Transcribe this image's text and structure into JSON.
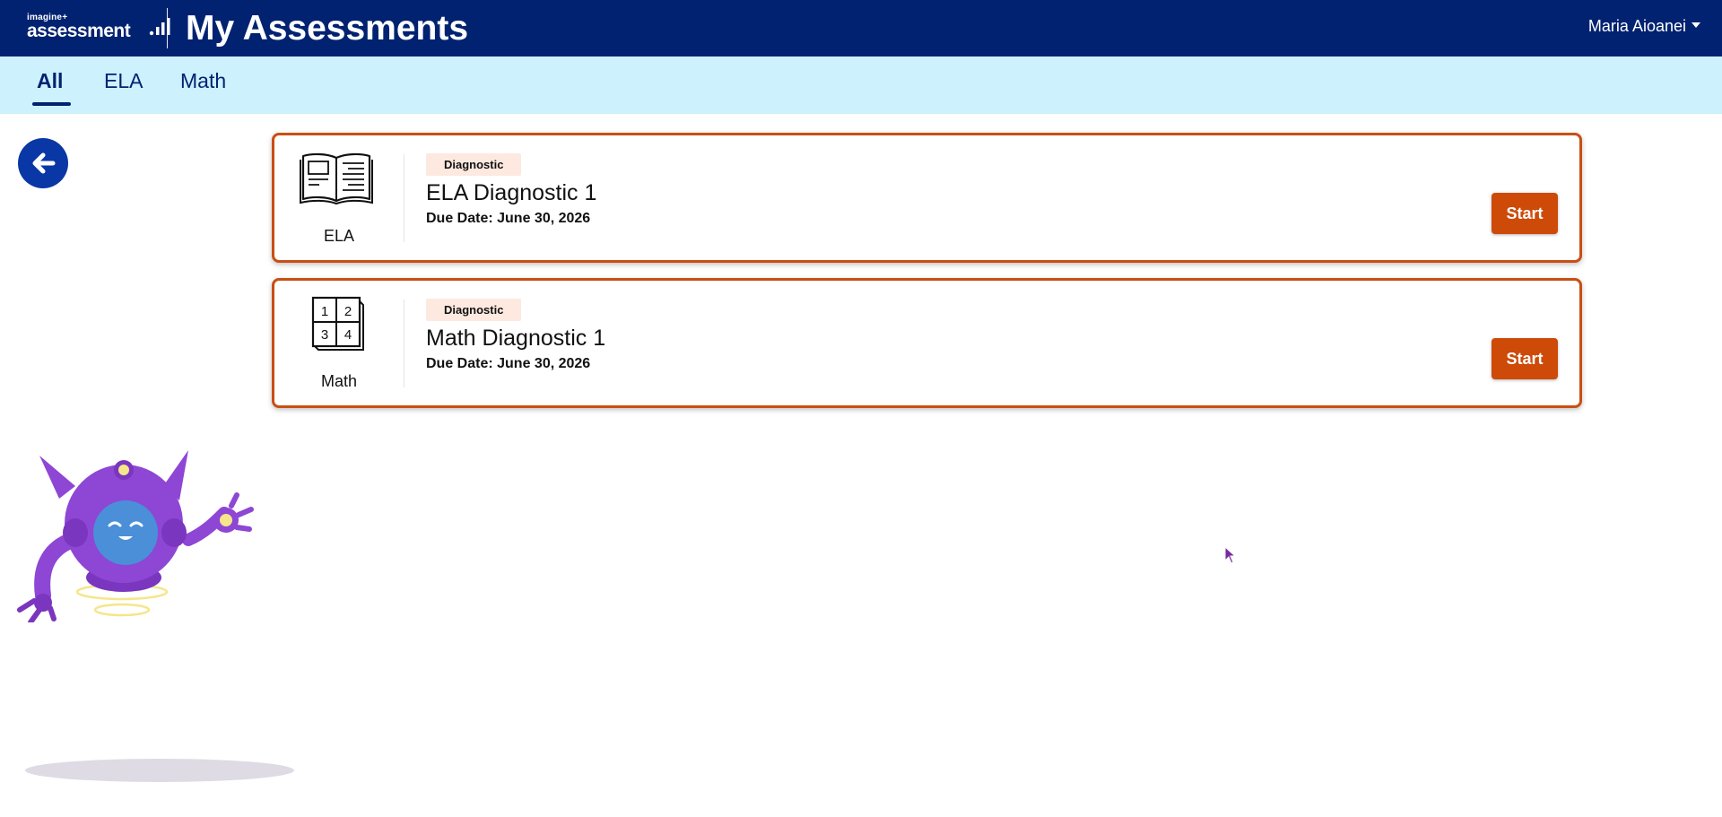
{
  "header": {
    "logo_small": "imagine+",
    "logo_big": "assessment",
    "page_title": "My Assessments",
    "user_name": "Maria Aioanei",
    "background": "#012271"
  },
  "tabs": [
    {
      "label": "All",
      "active": true
    },
    {
      "label": "ELA",
      "active": false
    },
    {
      "label": "Math",
      "active": false
    }
  ],
  "back_button": {
    "icon": "arrow-left-icon"
  },
  "assessments": [
    {
      "subject": "ELA",
      "subject_icon": "open-book-icon",
      "badge": "Diagnostic",
      "title": "ELA Diagnostic 1",
      "due": "Due Date: June 30, 2026",
      "action": "Start"
    },
    {
      "subject": "Math",
      "subject_icon": "number-grid-icon",
      "badge": "Diagnostic",
      "title": "Math Diagnostic 1",
      "due": "Due Date: June 30, 2026",
      "action": "Start",
      "grid_digits": [
        "1",
        "2",
        "3",
        "4"
      ]
    }
  ],
  "colors": {
    "accent": "#cd4a08",
    "tabbar": "#cdf1fd",
    "badge_bg": "#fde9e0",
    "mascot": "#8e46d4"
  }
}
